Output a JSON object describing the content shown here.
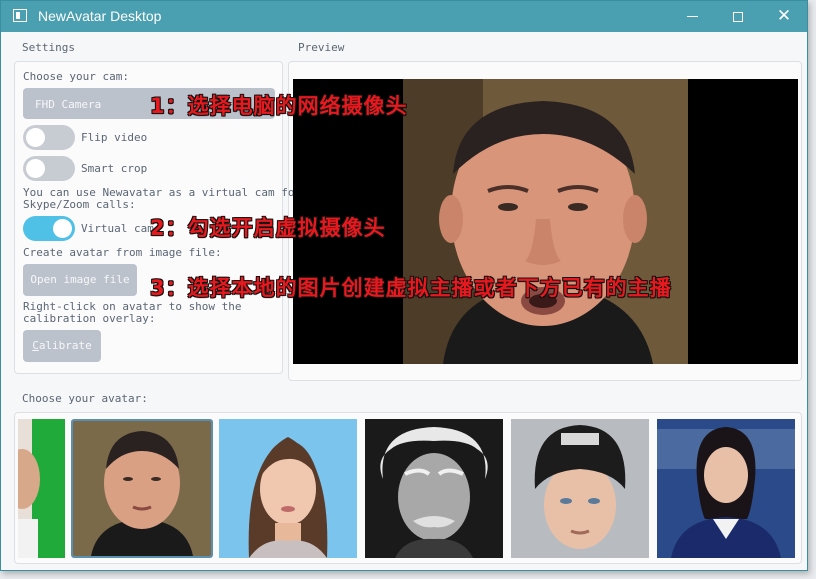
{
  "window": {
    "title": "NewAvatar Desktop"
  },
  "titlebar": {
    "close_glyph": "✕"
  },
  "sections": {
    "settings": "Settings",
    "preview": "Preview",
    "avatar": "Choose your avatar:"
  },
  "settings": {
    "cam_label": "Choose your cam:",
    "cam_value": "FHD Camera",
    "flip_label": "Flip video",
    "flip_on": false,
    "smart_crop_label": "Smart crop",
    "smart_crop_on": false,
    "virtual_cam_info_1": "You can use Newavatar as a virtual cam for",
    "virtual_cam_info_2": "Skype/Zoom calls:",
    "virtual_cam_label": "Virtual cam",
    "virtual_cam_on": true,
    "create_avatar_label": "Create avatar from image file:",
    "open_image_button": "Open image file",
    "calibration_info_1": "Right-click on avatar to show the",
    "calibration_info_2": "calibration overlay:",
    "calibrate_button": "Calibrate"
  },
  "annotations": {
    "step1": "1：选择电脑的网络摄像头",
    "step2": "2：勾选开启虚拟摄像头",
    "step3": "3：选择本地的图片创建虚拟主播或者下方已有的主播"
  },
  "avatars": [
    {
      "name": "partial-green-avatar",
      "selected": false
    },
    {
      "name": "bald-man-avatar",
      "selected": true
    },
    {
      "name": "woman-long-hair-avatar",
      "selected": false
    },
    {
      "name": "einstein-avatar",
      "selected": false
    },
    {
      "name": "man-beanie-avatar",
      "selected": false
    },
    {
      "name": "news-anchor-avatar",
      "selected": false
    }
  ],
  "colors": {
    "titlebar": "#4a9fb0",
    "accent_toggle": "#4fc0e6",
    "annotation": "#e8191e"
  }
}
